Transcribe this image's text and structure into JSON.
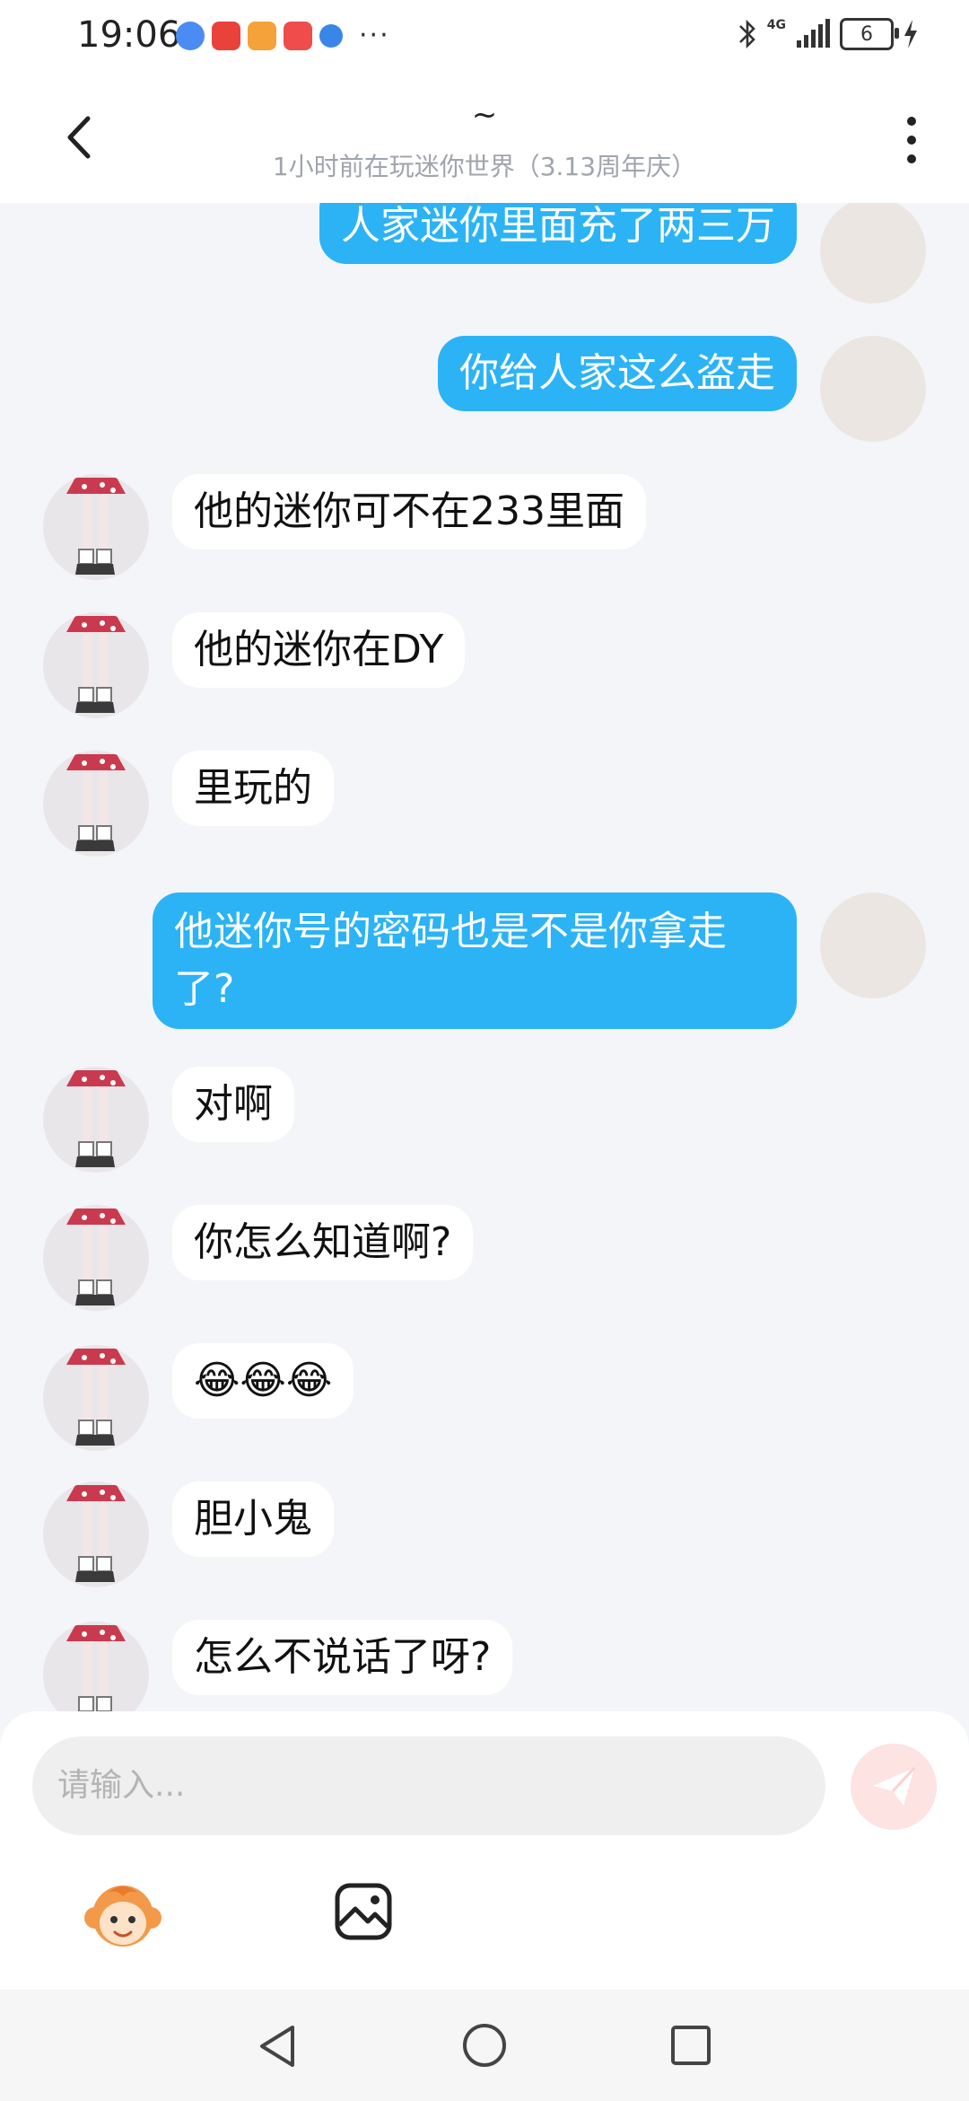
{
  "status_bar": {
    "time": "19:06",
    "network": "4G",
    "battery": "6",
    "app_icons": [
      "music-app-icon",
      "red-app-icon",
      "video-app-icon",
      "huawei-app-icon",
      "browser-app-icon"
    ],
    "more": "···"
  },
  "header": {
    "title": "~",
    "subtitle": "1小时前在玩迷你世界（3.13周年庆）"
  },
  "messages": [
    {
      "sender": "me",
      "text": "人家迷你里面充了两三万"
    },
    {
      "sender": "me",
      "text": "你给人家这么盗走"
    },
    {
      "sender": "other",
      "text": "他的迷你可不在233里面"
    },
    {
      "sender": "other",
      "text": "他的迷你在DY"
    },
    {
      "sender": "other",
      "text": "里玩的"
    },
    {
      "sender": "me",
      "text": "他迷你号的密码也是不是你拿走了?"
    },
    {
      "sender": "other",
      "text": "对啊"
    },
    {
      "sender": "other",
      "text": "你怎么知道啊?"
    },
    {
      "sender": "other",
      "text": "😂😂😂"
    },
    {
      "sender": "other",
      "text": "胆小鬼"
    },
    {
      "sender": "other",
      "text": "怎么不说话了呀?"
    }
  ],
  "composer": {
    "placeholder": "请输入..."
  },
  "colors": {
    "my_bubble": "#2bb3f6",
    "other_bubble": "#ffffff",
    "background": "#f4f5f9",
    "send_button": "#fde3e2"
  }
}
